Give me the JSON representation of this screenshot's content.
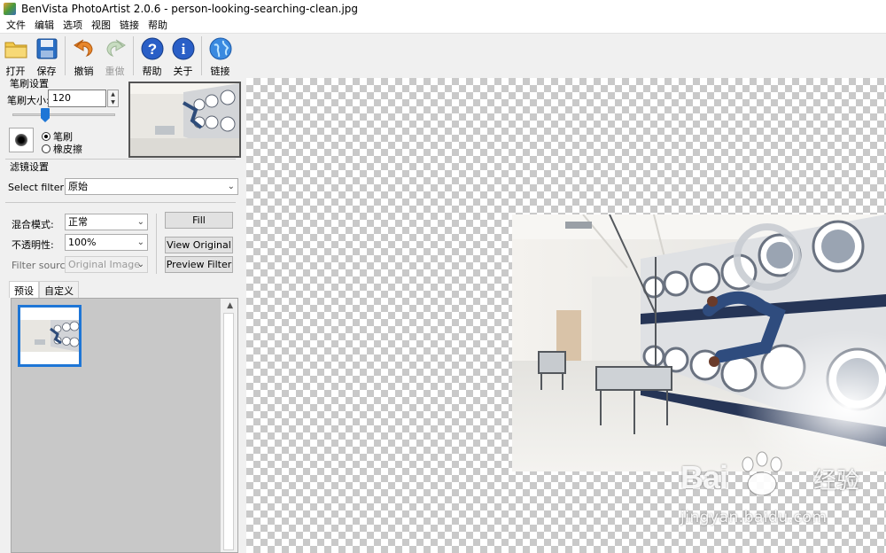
{
  "window": {
    "title": "BenVista PhotoArtist 2.0.6 - person-looking-searching-clean.jpg"
  },
  "menu": [
    "文件",
    "编辑",
    "选项",
    "视图",
    "链接",
    "帮助"
  ],
  "toolbar": {
    "open": "打开",
    "save": "保存",
    "undo": "撤销",
    "redo": "重做",
    "help": "帮助",
    "about": "关于",
    "link": "链接"
  },
  "brush": {
    "group_title": "笔刷设置",
    "size_label": "笔刷大小:",
    "size_value": "120",
    "slider_fraction": 0.3,
    "mode_brush": "笔刷",
    "mode_eraser": "橡皮擦",
    "selected_mode": "brush"
  },
  "filter": {
    "group_title": "滤镜设置",
    "select_label": "Select filter:",
    "select_value": "原始",
    "blend_label": "混合模式:",
    "blend_value": "正常",
    "opacity_label": "不透明性:",
    "opacity_value": "100%",
    "source_label": "Filter source:",
    "source_value": "Original Image",
    "fill_button": "Fill",
    "view_original_button": "View Original",
    "preview_filter_button": "Preview Filter"
  },
  "tabs": [
    "预设",
    "自定义"
  ],
  "active_tab": 0,
  "watermark": {
    "logo_left": "Bai",
    "logo_right": "经验",
    "url": "jingyan.baidu.com"
  },
  "colors": {
    "accent": "#1e76d6",
    "checker": "#c9c9c9"
  }
}
